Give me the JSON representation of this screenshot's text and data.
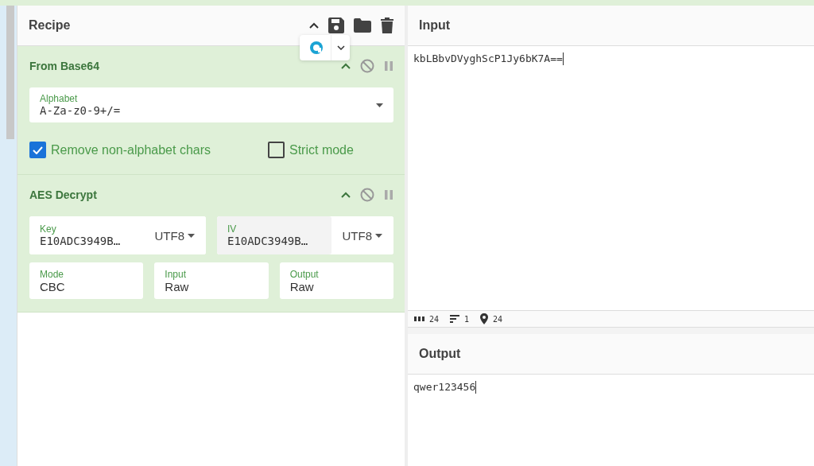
{
  "recipe": {
    "title": "Recipe",
    "operations": [
      {
        "name": "From Base64",
        "fields": [
          {
            "kind": "select",
            "label": "Alphabet",
            "value": "A-Za-z0-9+/="
          },
          {
            "kind": "checkbox",
            "label": "Remove non-alphabet chars",
            "checked": true
          },
          {
            "kind": "checkbox",
            "label": "Strict mode",
            "checked": false
          }
        ]
      },
      {
        "name": "AES Decrypt",
        "fields": [
          {
            "kind": "toggle",
            "label": "Key",
            "value": "E10ADC3949B…",
            "option": "UTF8",
            "disabled": false
          },
          {
            "kind": "toggle",
            "label": "IV",
            "value": "E10ADC3949B…",
            "option": "UTF8",
            "disabled": true
          },
          {
            "kind": "text",
            "label": "Mode",
            "value": "CBC"
          },
          {
            "kind": "text",
            "label": "Input",
            "value": "Raw"
          },
          {
            "kind": "text",
            "label": "Output",
            "value": "Raw"
          }
        ]
      }
    ]
  },
  "input": {
    "title": "Input",
    "value": "kbLBbvDVyghScP1Jy6bK7A==",
    "status": [
      {
        "kind": "length",
        "value": "24"
      },
      {
        "kind": "lines",
        "value": "1"
      },
      {
        "kind": "position",
        "value": "24"
      }
    ]
  },
  "output": {
    "title": "Output",
    "value": "qwer123456"
  }
}
